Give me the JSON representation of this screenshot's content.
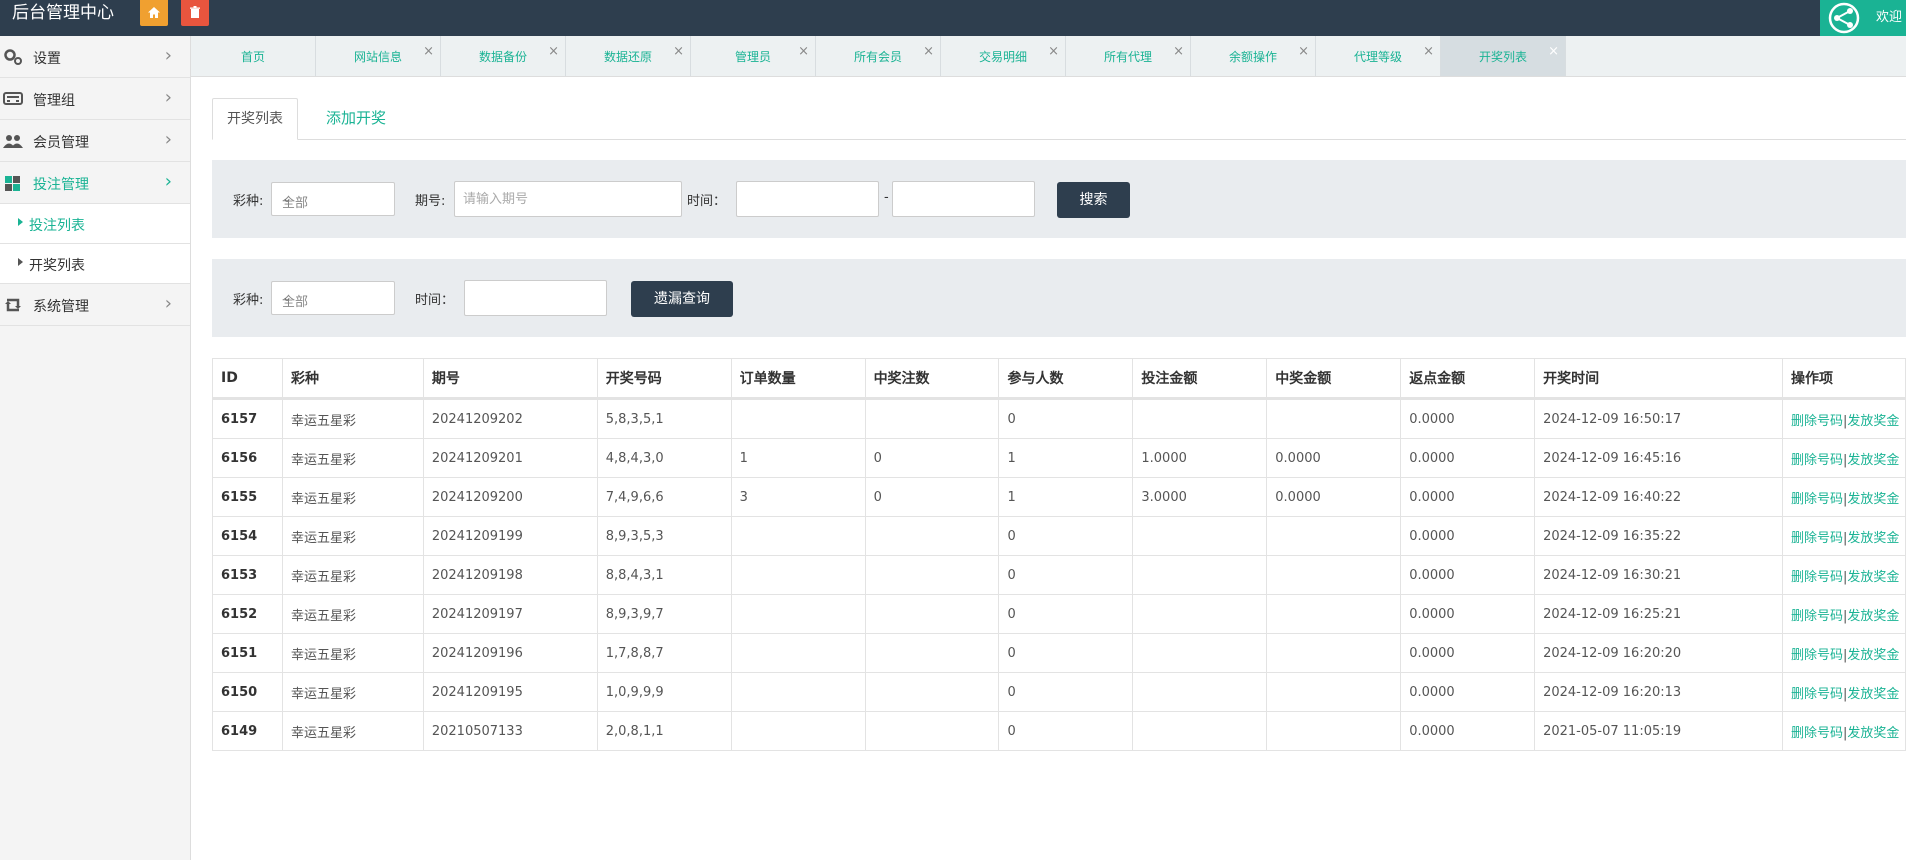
{
  "header": {
    "title": "后台管理中心",
    "welcome": "欢迎",
    "home_icon": "home-icon",
    "delete_icon": "trash-icon"
  },
  "sidebar": {
    "items": [
      {
        "label": "设置",
        "icon": "gear-icon"
      },
      {
        "label": "管理组",
        "icon": "keyboard-icon"
      },
      {
        "label": "会员管理",
        "icon": "users-icon"
      },
      {
        "label": "投注管理",
        "icon": "puzzle-icon"
      },
      {
        "label": "系统管理",
        "icon": "retweet-icon"
      }
    ],
    "subitems": [
      {
        "label": "投注列表"
      },
      {
        "label": "开奖列表"
      }
    ]
  },
  "tabs": [
    {
      "label": "首页"
    },
    {
      "label": "网站信息"
    },
    {
      "label": "数据备份"
    },
    {
      "label": "数据还原"
    },
    {
      "label": "管理员"
    },
    {
      "label": "所有会员"
    },
    {
      "label": "交易明细"
    },
    {
      "label": "所有代理"
    },
    {
      "label": "余额操作"
    },
    {
      "label": "代理等级"
    },
    {
      "label": "开奖列表"
    }
  ],
  "content_tabs": {
    "active": "开奖列表",
    "add": "添加开奖"
  },
  "search": {
    "lottery_label": "彩种:",
    "lottery_value": "全部",
    "period_label": "期号:",
    "period_placeholder": "请输入期号",
    "time_label": "时间：",
    "dash": "-",
    "button": "搜索"
  },
  "missing": {
    "lottery_label": "彩种:",
    "lottery_value": "全部",
    "time_label": "时间：",
    "button": "遗漏查询"
  },
  "table": {
    "headers": [
      "ID",
      "彩种",
      "期号",
      "开奖号码",
      "订单数量",
      "中奖注数",
      "参与人数",
      "投注金额",
      "中奖金额",
      "返点金额",
      "开奖时间",
      "操作项"
    ],
    "rows": [
      {
        "id": "6157",
        "lottery": "幸运五星彩",
        "period": "20241209202",
        "numbers": "5,8,3,5,1",
        "orders": "",
        "wins": "",
        "people": "0",
        "bet": "",
        "prize": "",
        "rebate": "0.0000",
        "time": "2024-12-09 16:50:17"
      },
      {
        "id": "6156",
        "lottery": "幸运五星彩",
        "period": "20241209201",
        "numbers": "4,8,4,3,0",
        "orders": "1",
        "wins": "0",
        "people": "1",
        "bet": "1.0000",
        "prize": "0.0000",
        "rebate": "0.0000",
        "time": "2024-12-09 16:45:16"
      },
      {
        "id": "6155",
        "lottery": "幸运五星彩",
        "period": "20241209200",
        "numbers": "7,4,9,6,6",
        "orders": "3",
        "wins": "0",
        "people": "1",
        "bet": "3.0000",
        "prize": "0.0000",
        "rebate": "0.0000",
        "time": "2024-12-09 16:40:22"
      },
      {
        "id": "6154",
        "lottery": "幸运五星彩",
        "period": "20241209199",
        "numbers": "8,9,3,5,3",
        "orders": "",
        "wins": "",
        "people": "0",
        "bet": "",
        "prize": "",
        "rebate": "0.0000",
        "time": "2024-12-09 16:35:22"
      },
      {
        "id": "6153",
        "lottery": "幸运五星彩",
        "period": "20241209198",
        "numbers": "8,8,4,3,1",
        "orders": "",
        "wins": "",
        "people": "0",
        "bet": "",
        "prize": "",
        "rebate": "0.0000",
        "time": "2024-12-09 16:30:21"
      },
      {
        "id": "6152",
        "lottery": "幸运五星彩",
        "period": "20241209197",
        "numbers": "8,9,3,9,7",
        "orders": "",
        "wins": "",
        "people": "0",
        "bet": "",
        "prize": "",
        "rebate": "0.0000",
        "time": "2024-12-09 16:25:21"
      },
      {
        "id": "6151",
        "lottery": "幸运五星彩",
        "period": "20241209196",
        "numbers": "1,7,8,8,7",
        "orders": "",
        "wins": "",
        "people": "0",
        "bet": "",
        "prize": "",
        "rebate": "0.0000",
        "time": "2024-12-09 16:20:20"
      },
      {
        "id": "6150",
        "lottery": "幸运五星彩",
        "period": "20241209195",
        "numbers": "1,0,9,9,9",
        "orders": "",
        "wins": "",
        "people": "0",
        "bet": "",
        "prize": "",
        "rebate": "0.0000",
        "time": "2024-12-09 16:20:13"
      },
      {
        "id": "6149",
        "lottery": "幸运五星彩",
        "period": "20210507133",
        "numbers": "2,0,8,1,1",
        "orders": "",
        "wins": "",
        "people": "0",
        "bet": "",
        "prize": "",
        "rebate": "0.0000",
        "time": "2021-05-07 11:05:19"
      }
    ],
    "op_delete": "删除号码",
    "op_sep": "|",
    "op_pay": "发放奖金"
  },
  "colors": {
    "accent": "#1ab394",
    "header_bg": "#2e3e4e",
    "home_btn": "#f0a030",
    "delete_btn": "#e8553e"
  }
}
